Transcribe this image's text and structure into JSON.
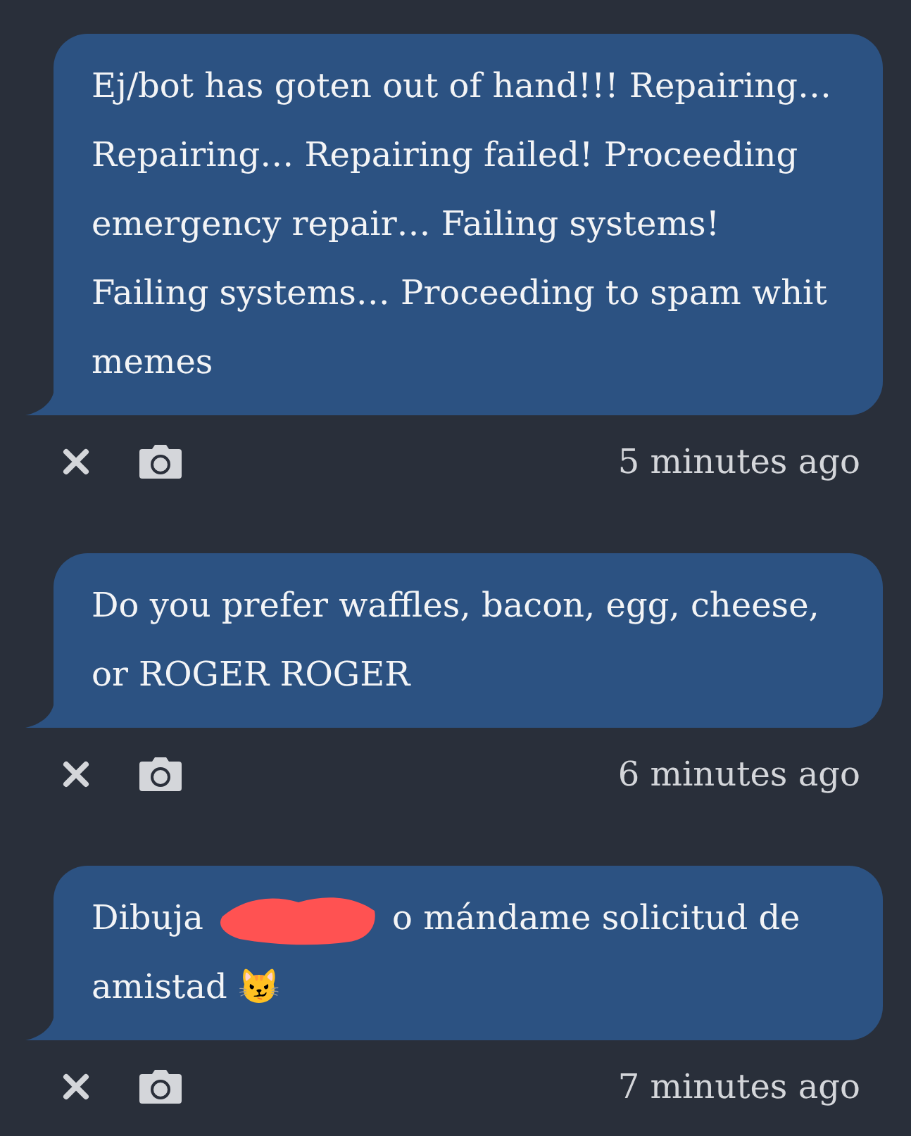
{
  "messages": [
    {
      "parts": [
        {
          "kind": "text",
          "text": "Ej/bot has goten out of hand!!! Repairing… Repairing… Repairing failed! Proceeding emergency repair… Failing systems! Failing systems… Proceeding to spam whit memes"
        }
      ],
      "time": "5 minutes ago"
    },
    {
      "parts": [
        {
          "kind": "text",
          "text": "Do you prefer waffles, bacon, egg, cheese, or ROGER ROGER"
        }
      ],
      "time": "6 minutes ago"
    },
    {
      "parts": [
        {
          "kind": "text",
          "text": "Dibuja"
        },
        {
          "kind": "redacted"
        },
        {
          "kind": "text",
          "text": "o mándame solicitud de"
        },
        {
          "kind": "text",
          "text": "amistad 😼"
        }
      ],
      "time": "7 minutes ago"
    }
  ]
}
